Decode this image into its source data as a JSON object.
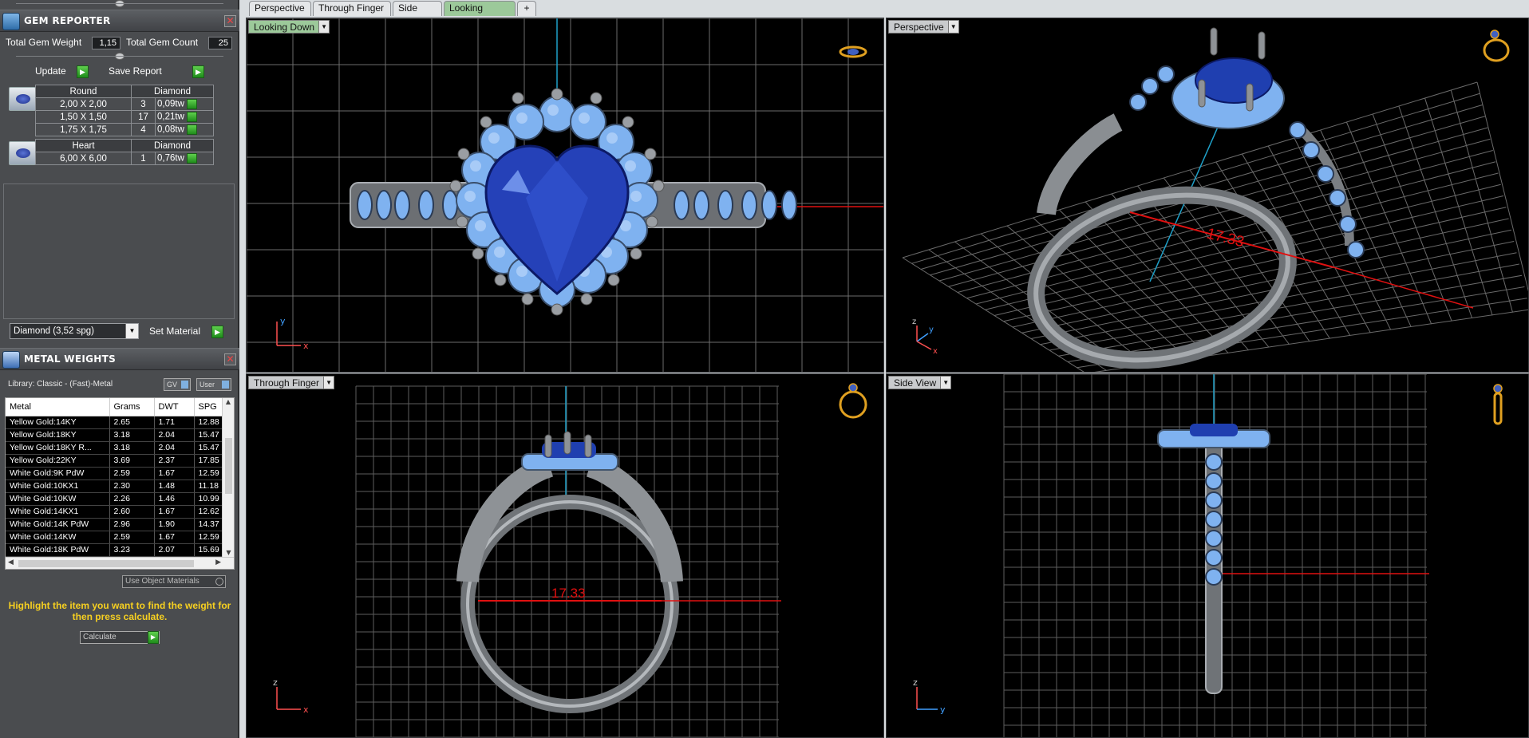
{
  "gem_reporter": {
    "title": "GEM REPORTER",
    "total_weight_label": "Total Gem Weight",
    "total_weight_value": "1,15",
    "total_count_label": "Total Gem Count",
    "total_count_value": "25",
    "update_label": "Update",
    "save_report_label": "Save Report",
    "groups": [
      {
        "shape": "Round",
        "material": "Diamond",
        "rows": [
          {
            "size": "2,00 X 2,00",
            "count": "3",
            "weight": "0,09tw"
          },
          {
            "size": "1,50 X 1,50",
            "count": "17",
            "weight": "0,21tw"
          },
          {
            "size": "1,75 X 1,75",
            "count": "4",
            "weight": "0,08tw"
          }
        ]
      },
      {
        "shape": "Heart",
        "material": "Diamond",
        "rows": [
          {
            "size": "6,00 X 6,00",
            "count": "1",
            "weight": "0,76tw"
          }
        ]
      }
    ],
    "material_select": "Diamond    (3,52 spg)",
    "set_material_label": "Set Material"
  },
  "metal_weights": {
    "title": "METAL WEIGHTS",
    "library": "Library: Classic - (Fast)-Metal",
    "gv_label": "GV",
    "user_label": "User",
    "columns": [
      "Metal",
      "Grams",
      "DWT",
      "SPG"
    ],
    "rows": [
      [
        "Yellow Gold:14KY",
        "2.65",
        "1.71",
        "12.88"
      ],
      [
        "Yellow Gold:18KY",
        "3.18",
        "2.04",
        "15.47"
      ],
      [
        "Yellow Gold:18KY R...",
        "3.18",
        "2.04",
        "15.47"
      ],
      [
        "Yellow Gold:22KY",
        "3.69",
        "2.37",
        "17.85"
      ],
      [
        "White Gold:9K PdW",
        "2.59",
        "1.67",
        "12.59"
      ],
      [
        "White Gold:10KX1",
        "2.30",
        "1.48",
        "11.18"
      ],
      [
        "White Gold:10KW",
        "2.26",
        "1.46",
        "10.99"
      ],
      [
        "White Gold:14KX1",
        "2.60",
        "1.67",
        "12.62"
      ],
      [
        "White Gold:14K PdW",
        "2.96",
        "1.90",
        "14.37"
      ],
      [
        "White Gold:14KW",
        "2.59",
        "1.67",
        "12.59"
      ],
      [
        "White Gold:18K PdW",
        "3.23",
        "2.07",
        "15.69"
      ]
    ],
    "use_object_materials": "Use Object Materials",
    "hint": "Highlight the item you want to find the weight for then press calculate.",
    "calculate_label": "Calculate"
  },
  "tabs": [
    "Perspective",
    "Through Finger",
    "Side View",
    "Looking Down",
    "+"
  ],
  "active_tab": "Looking Down",
  "viewports": {
    "top_left": {
      "label": "Looking Down",
      "axis_a": "y",
      "axis_b": "x"
    },
    "top_right": {
      "label": "Perspective",
      "dimension": "17.33",
      "axis_a": "z",
      "axis_b": "y",
      "axis_c": "x"
    },
    "bottom_left": {
      "label": "Through Finger",
      "dimension": "17.33",
      "axis_a": "z",
      "axis_b": "x"
    },
    "bottom_right": {
      "label": "Side View",
      "axis_a": "z",
      "axis_b": "y"
    }
  },
  "colors": {
    "panel_bg": "#4a4c4f",
    "viewport_bg": "#000000",
    "grid": "#8a8a8a",
    "metal": "#9b9fa4",
    "accent_stone": "#7fb2f0",
    "center_stone": "#1f3fb0",
    "dimension": "#e01010",
    "hint": "#f7d020"
  }
}
